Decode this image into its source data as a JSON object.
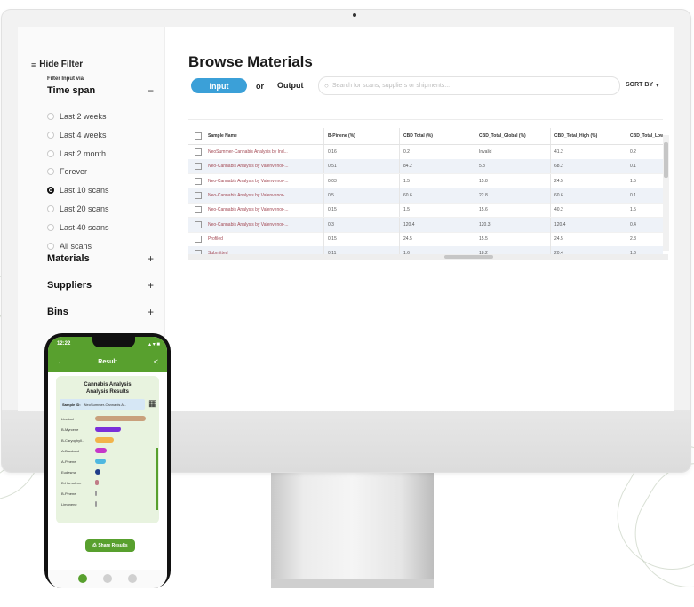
{
  "filter": {
    "hide_label": "Hide Filter",
    "hide_glyph": "≡",
    "sub_label": "Filter Input via",
    "time_span_title": "Time span",
    "time_span_sign": "−",
    "options": [
      "Last 2 weeks",
      "Last 4 weeks",
      "Last 2 month",
      "Forever",
      "Last 10 scans",
      "Last 20 scans",
      "Last 40 scans",
      "All scans"
    ],
    "selected_option": "Last 10 scans",
    "sections": [
      {
        "title": "Materials",
        "sign": "+"
      },
      {
        "title": "Suppliers",
        "sign": "+"
      },
      {
        "title": "Bins",
        "sign": "+"
      }
    ]
  },
  "main": {
    "title": "Browse Materials",
    "toggle_input": "Input",
    "or_label": "or",
    "toggle_output": "Output",
    "search_placeholder": "Search for scans, suppliers or shipments...",
    "search_icon": "search-icon",
    "sort_label": "SORT BY",
    "sort_icon": "▾"
  },
  "table": {
    "columns": [
      "Sample Name",
      "B-Pinene (%)",
      "CBD Total (%)",
      "CBD_Total_Global (%)",
      "CBD_Total_High (%)",
      "CBD_Total_Low"
    ],
    "rows": [
      [
        "NeoSummer-Cannabis Analysis by Ind...",
        "0.16",
        "0.2",
        "Invalid",
        "41.2",
        "0.2"
      ],
      [
        "Neo-Cannabis Analysis by Valenvenor-...",
        "0.51",
        "84.2",
        "5.8",
        "68.2",
        "0.1"
      ],
      [
        "Neo-Cannabis Analysis by Valenvenor-...",
        "0.03",
        "1.5",
        "15.8",
        "24.5",
        "1.5"
      ],
      [
        "Neo-Cannabis Analysis by Valenvenor-...",
        "0.5",
        "60.6",
        "22.8",
        "60.6",
        "0.1"
      ],
      [
        "Neo-Cannabis Analysis by Valenvenor-...",
        "0.15",
        "1.5",
        "15.6",
        "40.2",
        "1.5"
      ],
      [
        "Neo-Cannabis Analysis by Valenvenor-...",
        "0.3",
        "120.4",
        "120.3",
        "120.4",
        "0.4"
      ],
      [
        "Profiled",
        "0.15",
        "24.5",
        "15.5",
        "24.5",
        "2.3"
      ],
      [
        "Submitted",
        "0.11",
        "1.6",
        "18.2",
        "20.4",
        "1.6"
      ]
    ]
  },
  "phone": {
    "time": "12:22",
    "signal": "▴ ▾ ■",
    "back_icon": "←",
    "header_title": "Result",
    "share_icon": "<",
    "card_title_1": "Cannabis Analysis",
    "card_title_2": "Analysis Results",
    "sample_label": "Sample ID:",
    "sample_value": "NeoSummer-Cannabis A...",
    "qr_icon": "▦",
    "bars": [
      {
        "label": "Linalool",
        "color": "#c9a07c",
        "value": 0.95
      },
      {
        "label": "B-Myrcene",
        "color": "#7a2fd9",
        "value": 0.48
      },
      {
        "label": "B-Caryophyll...",
        "color": "#f2b34a",
        "value": 0.35
      },
      {
        "label": "A-Bisabolol",
        "color": "#c637c9",
        "value": 0.22
      },
      {
        "label": "A-Pinene",
        "color": "#4fb8e0",
        "value": 0.2
      },
      {
        "label": "Eudesma",
        "color": "#1f3e8a",
        "value": 0.1
      },
      {
        "label": "D-Humulene",
        "color": "#c07b87",
        "value": 0.07
      },
      {
        "label": "B-Pinene",
        "color": "#9c9c9c",
        "value": 0.02
      },
      {
        "label": "Limonene",
        "color": "#9c9c9c",
        "value": 0.01
      }
    ],
    "button_label": "Share Results",
    "button_icon": "⎙"
  },
  "colors": {
    "accent_blue": "#3ba0d8",
    "brand_green": "#58a02e",
    "row_alt": "#eef2f8",
    "sample_name": "#a44a55"
  }
}
